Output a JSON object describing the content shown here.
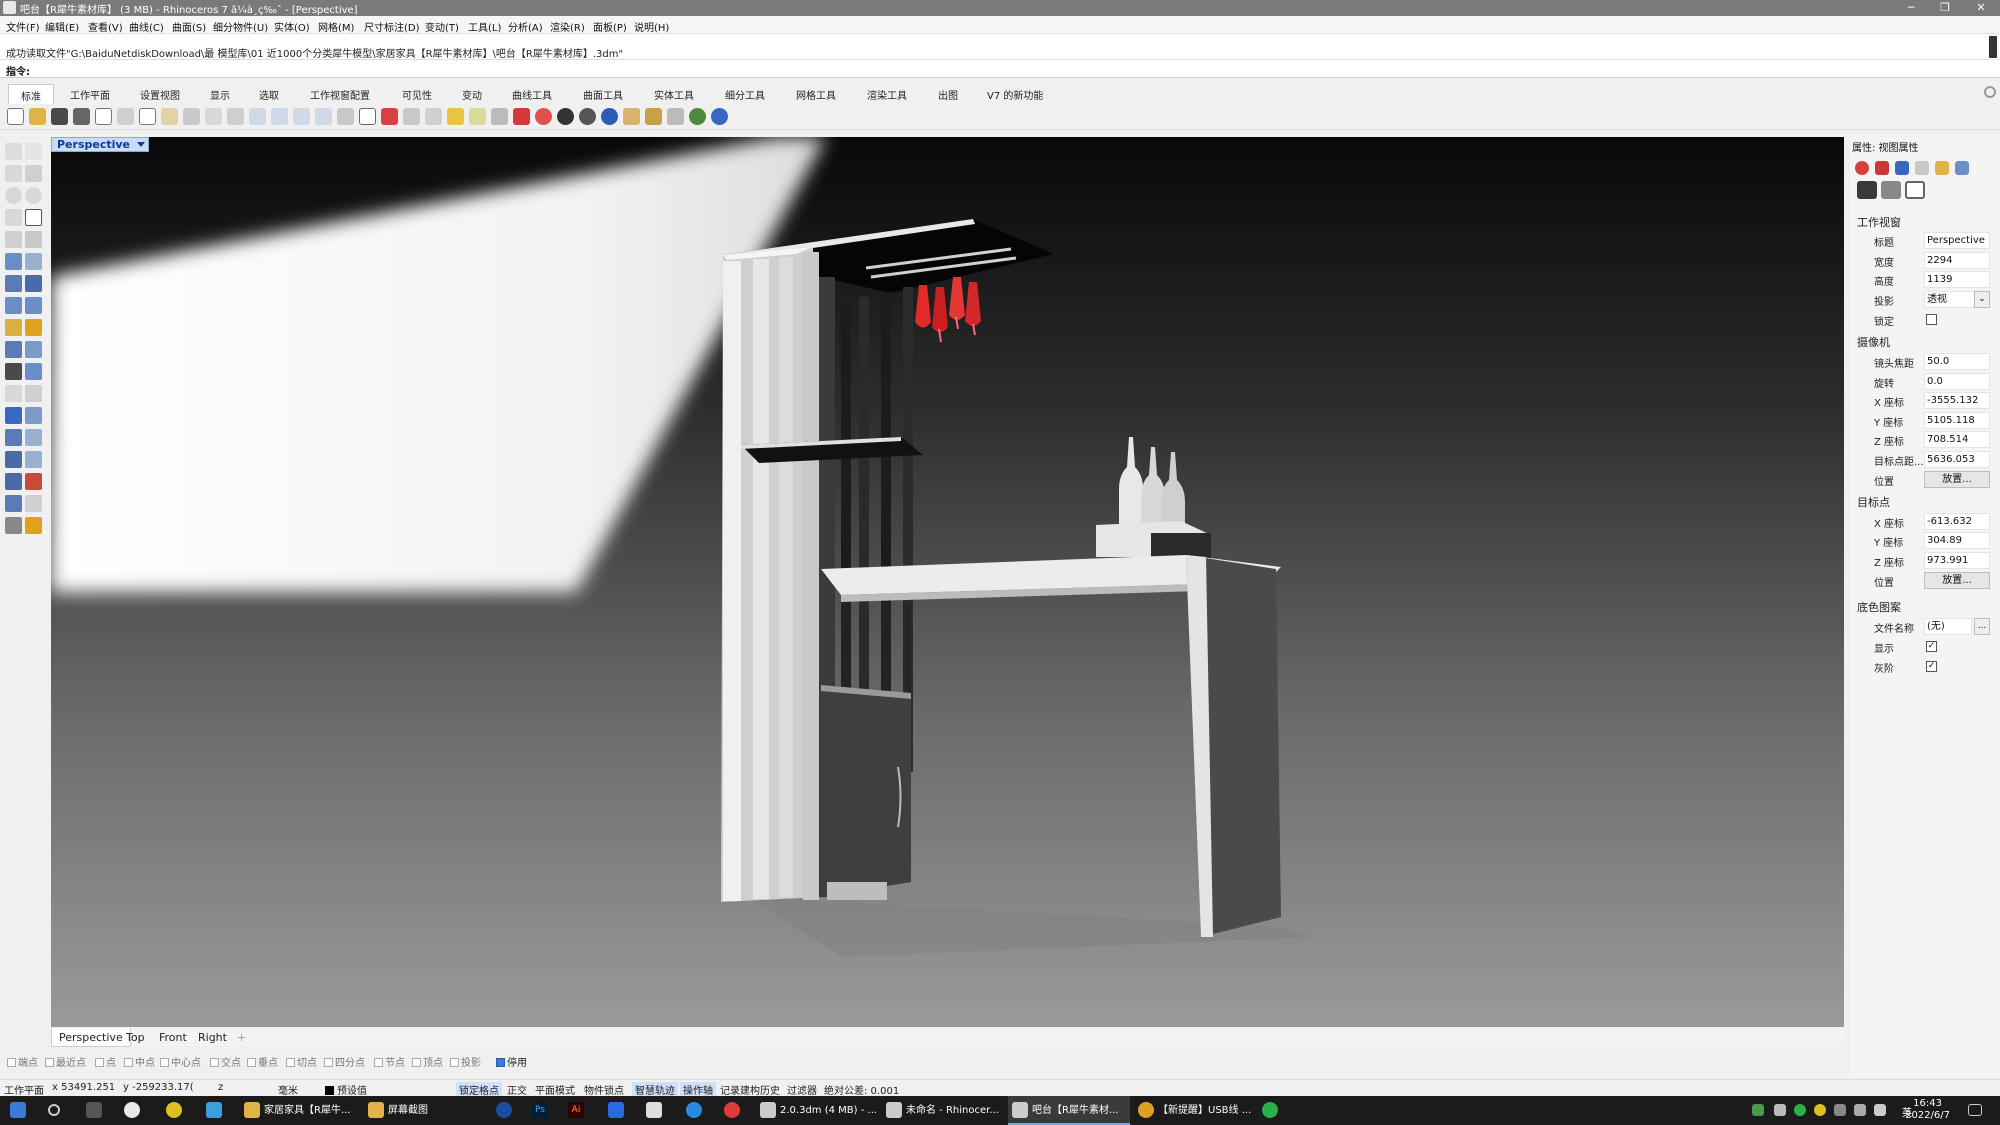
{
  "window": {
    "title": "吧台【R犀牛素材库】 (3 MB) - Rhinoceros 7 â¼à¸ç‰ˆ - [Perspective]",
    "controls": [
      "─",
      "❐",
      "✕"
    ]
  },
  "menu": [
    "文件(F)",
    "编辑(E)",
    "查看(V)",
    "曲线(C)",
    "曲面(S)",
    "细分物件(U)",
    "实体(O)",
    "网格(M)",
    "尺寸标注(D)",
    "变动(T)",
    "工具(L)",
    "分析(A)",
    "渲染(R)",
    "面板(P)",
    "说明(H)"
  ],
  "command": {
    "history_line": "成功读取文件\"G:\\BaiduNetdiskDownload\\最 模型库\\01 近1000个分类犀牛模型\\家居家具【R犀牛素材库】\\吧台【R犀牛素材库】.3dm\"",
    "prompt": "指令:"
  },
  "toolbar_tabs": [
    "标准",
    "工作平面",
    "设置视图",
    "显示",
    "选取",
    "工作视窗配置",
    "可见性",
    "变动",
    "曲线工具",
    "曲面工具",
    "实体工具",
    "细分工具",
    "网格工具",
    "渲染工具",
    "出图",
    "V7 的新功能"
  ],
  "active_toolbar_tab": "标准",
  "viewport": {
    "label": "Perspective"
  },
  "view_tabs": [
    "Perspective",
    "Top",
    "Front",
    "Right",
    "+"
  ],
  "osnaps": [
    {
      "label": "端点",
      "checked": false
    },
    {
      "label": "最近点",
      "checked": false
    },
    {
      "label": "点",
      "checked": false
    },
    {
      "label": "中点",
      "checked": false
    },
    {
      "label": "中心点",
      "checked": false
    },
    {
      "label": "交点",
      "checked": false
    },
    {
      "label": "垂点",
      "checked": false
    },
    {
      "label": "切点",
      "checked": false
    },
    {
      "label": "四分点",
      "checked": false
    },
    {
      "label": "节点",
      "checked": false
    },
    {
      "label": "顶点",
      "checked": false
    },
    {
      "label": "投影",
      "checked": false
    },
    {
      "label": "停用",
      "checked": true
    }
  ],
  "status": {
    "cplane": "工作平面",
    "x": "x 53491.251",
    "y": "y -259233.17(",
    "z": "z",
    "units": "毫米",
    "layer": "预设值",
    "toggles": [
      "锁定格点",
      "正交",
      "平面模式",
      "物件锁点",
      "智慧轨迹",
      "操作轴",
      "记录建构历史",
      "过滤器"
    ],
    "tolerance": "绝对公差: 0.001"
  },
  "properties": {
    "header": "属性: 视图属性",
    "viewport_section": "工作视窗",
    "title_label": "标题",
    "title_value": "Perspective",
    "width_label": "宽度",
    "width_value": "2294",
    "height_label": "高度",
    "height_value": "1139",
    "projection_label": "投影",
    "projection_value": "透视",
    "lock_label": "锁定",
    "lock_value": "",
    "camera_section": "摄像机",
    "focal_label": "镜头焦距",
    "focal_value": "50.0",
    "rotation_label": "旋转",
    "rotation_value": "0.0",
    "cx_label": "X 座标",
    "cx_value": "-3555.132",
    "cy_label": "Y 座标",
    "cy_value": "5105.118",
    "cz_label": "Z 座标",
    "cz_value": "708.514",
    "dist_label": "目标点距...",
    "dist_value": "5636.053",
    "cam_pos_label": "位置",
    "cam_pos_button": "放置...",
    "target_section": "目标点",
    "tx_label": "X 座标",
    "tx_value": "-613.632",
    "ty_label": "Y 座标",
    "ty_value": "304.89",
    "tz_label": "Z 座标",
    "tz_value": "973.991",
    "tgt_pos_label": "位置",
    "tgt_pos_button": "放置...",
    "wallpaper_section": "底色图案",
    "file_label": "文件名称",
    "file_value": "(无)",
    "file_browse": "...",
    "show_label": "显示",
    "show_value": "✓",
    "gray_label": "灰阶",
    "gray_value": "✓"
  },
  "taskbar": {
    "apps": [
      "家居家具【R犀牛...",
      "屏幕截图",
      "2.0.3dm (4 MB) - ...",
      "未命名 - Rhinocer...",
      "吧台【R犀牛素材...",
      "【新提醒】USB线 ..."
    ],
    "time": "16:43",
    "date": "2022/6/7",
    "ime": "英"
  }
}
